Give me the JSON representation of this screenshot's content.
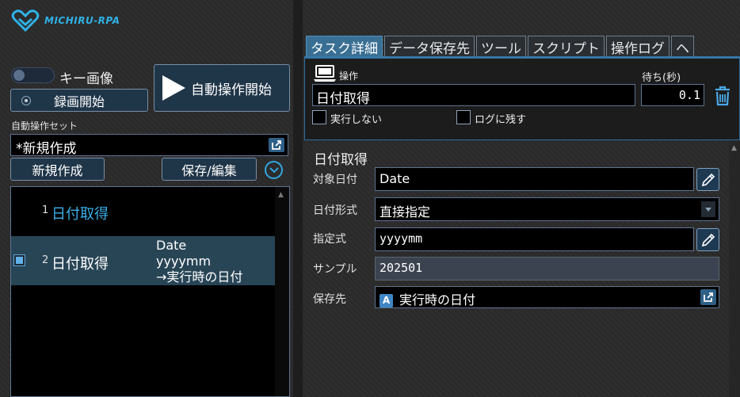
{
  "app": {
    "brand": "MICHIRU-RPA"
  },
  "left": {
    "key_image_label": "キー画像",
    "record_button": "録画開始",
    "start_button": "自動操作開始",
    "set_label": "自動操作セット",
    "set_value": "*新規作成",
    "new_button": "新規作成",
    "save_button": "保存/編集",
    "steps": [
      {
        "num": "1",
        "name": "日付取得"
      },
      {
        "num": "2",
        "name": "日付取得",
        "desc_line1": "Date",
        "desc_line2": "yyyymm",
        "desc_line3": "→実行時の日付"
      }
    ]
  },
  "right": {
    "tabs": [
      "タスク詳細",
      "データ保存先",
      "ツール",
      "スクリプト",
      "操作ログ",
      "ヘ"
    ],
    "operation_label": "操作",
    "operation_value": "日付取得",
    "wait_label": "待ち(秒)",
    "wait_value": "0.1",
    "checkbox_no_run": "実行しない",
    "checkbox_keep_log": "ログに残す",
    "detail": {
      "title": "日付取得",
      "target_date_label": "対象日付",
      "target_date_value": "Date",
      "date_format_label": "日付形式",
      "date_format_value": "直接指定",
      "expression_label": "指定式",
      "expression_value": "yyyymm",
      "sample_label": "サンプル",
      "sample_value": "202501",
      "save_to_label": "保存先",
      "save_to_badge": "A",
      "save_to_value": "実行時の日付"
    }
  },
  "colors": {
    "accent": "#2fb1e6",
    "tab_active": "#3a6f94",
    "selected_row": "#284556"
  }
}
